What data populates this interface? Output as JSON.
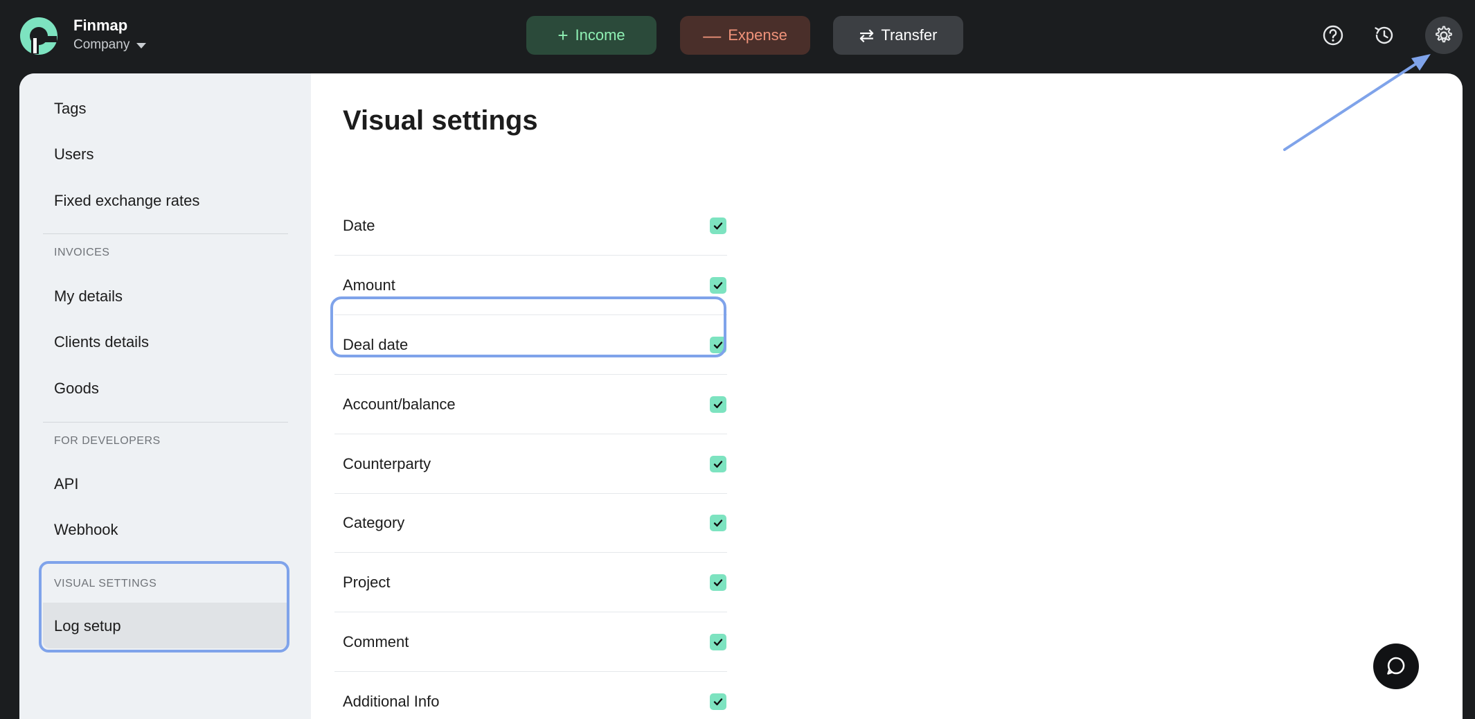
{
  "app": {
    "name": "Finmap",
    "company": "Company"
  },
  "toolbar": {
    "income_label": "Income",
    "expense_label": "Expense",
    "transfer_label": "Transfer",
    "income_glyph": "+",
    "expense_glyph": "—",
    "transfer_glyph": "⇄"
  },
  "icons": {
    "help": "help-circle-icon",
    "history": "history-icon",
    "settings": "gear-icon",
    "chat": "chat-bubble-icon"
  },
  "colors": {
    "income": "#8ff0b4",
    "expense": "#f0937a",
    "checkbox": "#7de3c0",
    "highlight": "#7fa3ea"
  },
  "sidebar": {
    "items_top": [
      "Tags",
      "Users",
      "Fixed exchange rates"
    ],
    "invoices_heading": "INVOICES",
    "invoices_items": [
      "My details",
      "Clients details",
      "Goods"
    ],
    "developers_heading": "FOR DEVELOPERS",
    "developers_items": [
      "API",
      "Webhook"
    ],
    "visual_heading": "VISUAL SETTINGS",
    "visual_items": [
      "Log setup"
    ]
  },
  "main": {
    "title": "Visual settings",
    "fields": [
      {
        "label": "Date",
        "checked": true
      },
      {
        "label": "Amount",
        "checked": true
      },
      {
        "label": "Deal date",
        "checked": true
      },
      {
        "label": "Account/balance",
        "checked": true
      },
      {
        "label": "Counterparty",
        "checked": true
      },
      {
        "label": "Category",
        "checked": true
      },
      {
        "label": "Project",
        "checked": true
      },
      {
        "label": "Comment",
        "checked": true
      },
      {
        "label": "Additional Info",
        "checked": true
      }
    ]
  }
}
